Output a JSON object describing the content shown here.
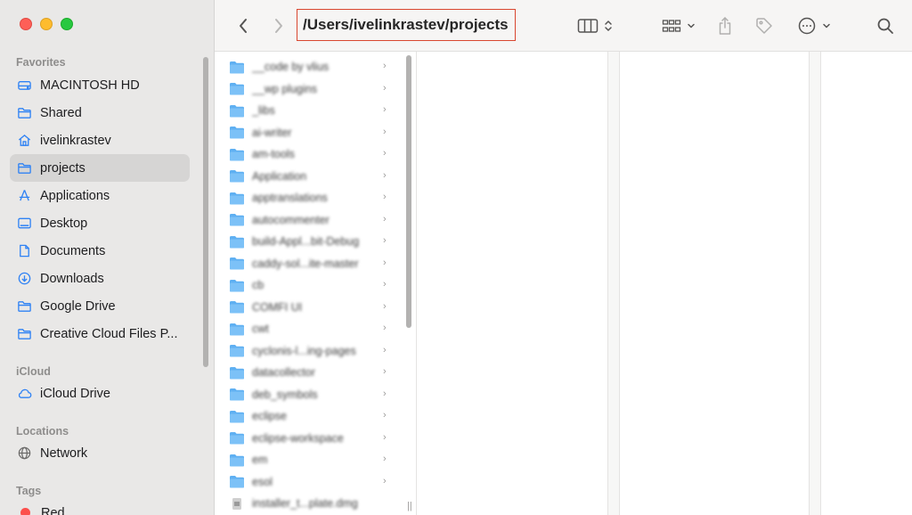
{
  "window": {
    "traffic_lights": [
      "close",
      "minimize",
      "zoom"
    ]
  },
  "toolbar": {
    "path": "/Users/ivelinkrastev/projects",
    "back_icon": "chevron-left-icon",
    "forward_icon": "chevron-right-icon",
    "view_icon": "columns-view-icon",
    "group_icon": "grid-group-icon",
    "share_icon": "share-icon",
    "tag_icon": "tag-icon",
    "more_icon": "more-circle-icon",
    "search_icon": "search-icon",
    "accent_color": "#d9462f"
  },
  "sidebar": {
    "favorites_label": "Favorites",
    "favorites": [
      {
        "label": "MACINTOSH HD",
        "icon": "hard-drive-icon"
      },
      {
        "label": "Shared",
        "icon": "folder-icon"
      },
      {
        "label": "ivelinkrastev",
        "icon": "home-icon"
      },
      {
        "label": "projects",
        "icon": "folder-icon"
      },
      {
        "label": "Applications",
        "icon": "applications-icon"
      },
      {
        "label": "Desktop",
        "icon": "desktop-icon"
      },
      {
        "label": "Documents",
        "icon": "document-icon"
      },
      {
        "label": "Downloads",
        "icon": "download-icon"
      },
      {
        "label": "Google Drive",
        "icon": "folder-icon"
      },
      {
        "label": "Creative Cloud Files P...",
        "icon": "folder-icon"
      }
    ],
    "icloud_label": "iCloud",
    "icloud": [
      {
        "label": "iCloud Drive",
        "icon": "cloud-icon"
      }
    ],
    "locations_label": "Locations",
    "locations": [
      {
        "label": "Network",
        "icon": "globe-icon"
      }
    ],
    "tags_label": "Tags",
    "tags": [
      {
        "label": "Red",
        "color": "#fc4f4c"
      }
    ],
    "selected": "projects"
  },
  "files": [
    {
      "name": "__code by vlius",
      "type": "folder"
    },
    {
      "name": "__wp plugins",
      "type": "folder"
    },
    {
      "name": "_libs",
      "type": "folder"
    },
    {
      "name": "ai-writer",
      "type": "folder"
    },
    {
      "name": "am-tools",
      "type": "folder"
    },
    {
      "name": "Application",
      "type": "folder"
    },
    {
      "name": "apptranslations",
      "type": "folder"
    },
    {
      "name": "autocommenter",
      "type": "folder"
    },
    {
      "name": "build-Appl...bit-Debug",
      "type": "folder"
    },
    {
      "name": "caddy-sol...ite-master",
      "type": "folder"
    },
    {
      "name": "cb",
      "type": "folder"
    },
    {
      "name": "COMFI UI",
      "type": "folder"
    },
    {
      "name": "cwt",
      "type": "folder"
    },
    {
      "name": "cyclonis-l...ing-pages",
      "type": "folder"
    },
    {
      "name": "datacollector",
      "type": "folder"
    },
    {
      "name": "deb_symbols",
      "type": "folder"
    },
    {
      "name": "eclipse",
      "type": "folder"
    },
    {
      "name": "eclipse-workspace",
      "type": "folder"
    },
    {
      "name": "em",
      "type": "folder"
    },
    {
      "name": "esol",
      "type": "folder"
    },
    {
      "name": "installer_t...plate.dmg",
      "type": "file"
    }
  ]
}
